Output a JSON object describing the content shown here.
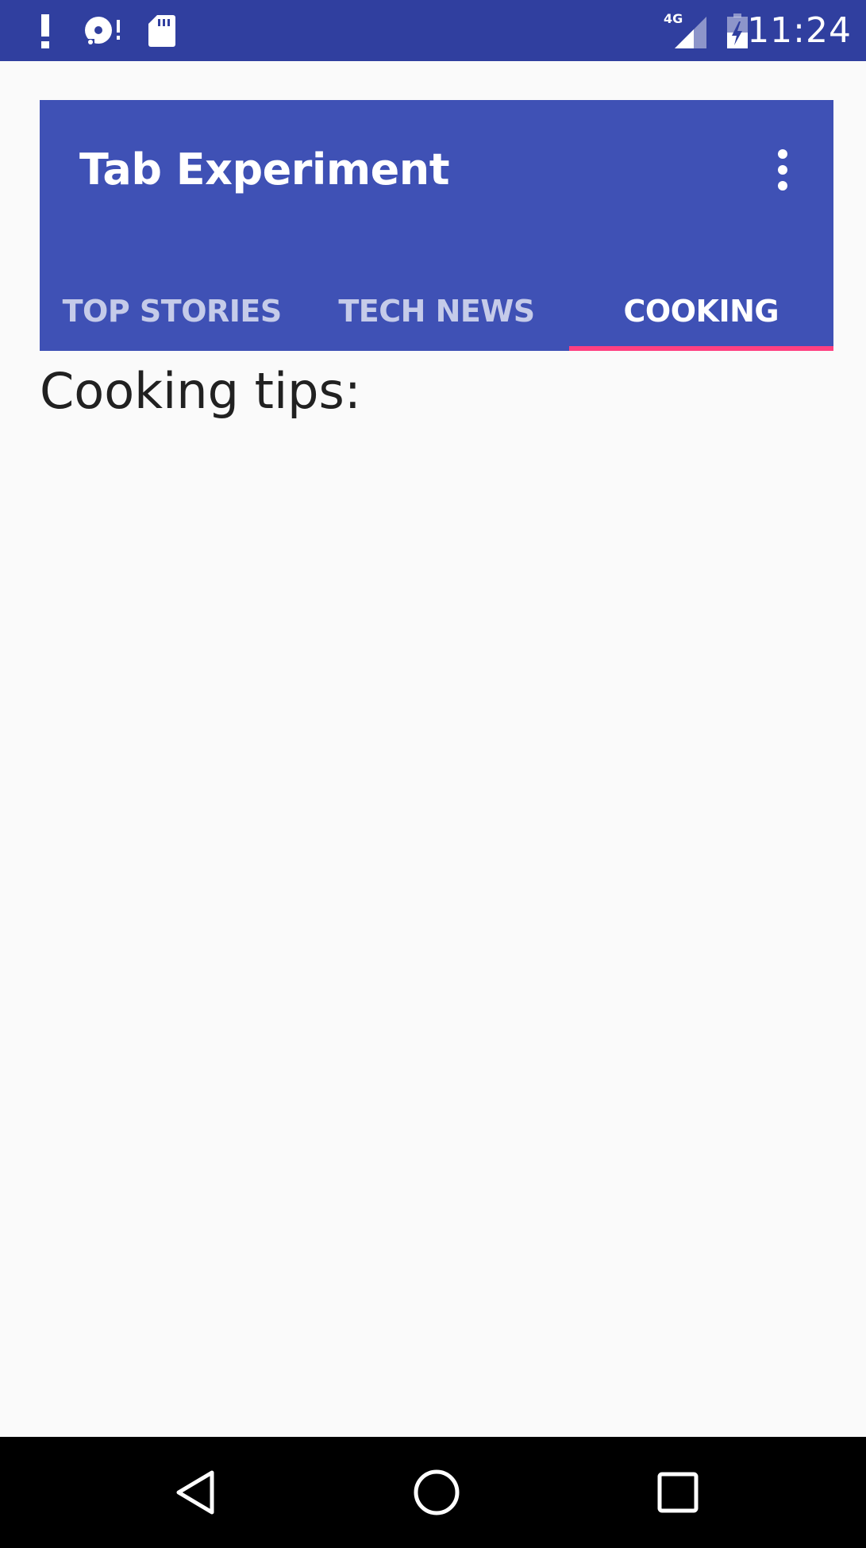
{
  "status_bar": {
    "time": "11:24",
    "network_label": "4G",
    "background_color": "#303f9f",
    "icons_left": [
      "alert-icon",
      "disc-alert-icon",
      "sd-card-icon"
    ],
    "icons_right": [
      "signal-icon",
      "battery-charging-icon"
    ]
  },
  "app_bar": {
    "title": "Tab Experiment",
    "background_color": "#3f51b5",
    "overflow_icon": "more-vert-icon"
  },
  "tabs": [
    {
      "label": "TOP STORIES",
      "selected": false
    },
    {
      "label": "TECH NEWS",
      "selected": false
    },
    {
      "label": "COOKING",
      "selected": true
    }
  ],
  "tab_indicator_color": "#ff4081",
  "page": {
    "text": "Cooking tips:"
  },
  "nav_bar": {
    "buttons": [
      "back-icon",
      "home-icon",
      "recents-icon"
    ]
  }
}
